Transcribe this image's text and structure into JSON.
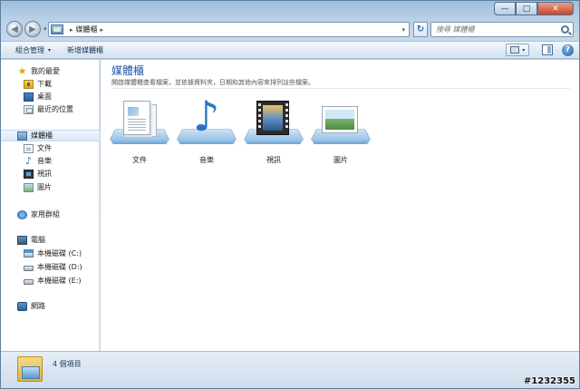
{
  "window": {
    "caption_buttons": {
      "minimize": "—",
      "maximize": "□",
      "close": "✕"
    }
  },
  "nav": {
    "back": "◀",
    "forward": "▶",
    "history_dropdown": "▾"
  },
  "address": {
    "icon": "library-icon",
    "separator": "▸",
    "path": "媒體櫃",
    "trailing_separator": "▸",
    "dropdown": "▾"
  },
  "refresh": {
    "glyph": "↻"
  },
  "search": {
    "placeholder": "搜尋 媒體櫃"
  },
  "toolbar": {
    "organize_label": "組合管理",
    "organize_dropdown": "▾",
    "new_library_label": "新增媒體櫃",
    "view_dropdown": "▾",
    "help_glyph": "?"
  },
  "sidebar": {
    "favorites": {
      "label": "我的最愛",
      "items": [
        {
          "label": "下載",
          "icon": "download-folder-icon"
        },
        {
          "label": "桌面",
          "icon": "desktop-icon"
        },
        {
          "label": "最近的位置",
          "icon": "recent-places-icon"
        }
      ]
    },
    "libraries": {
      "label": "媒體櫃",
      "items": [
        {
          "label": "文件",
          "icon": "documents-icon"
        },
        {
          "label": "音樂",
          "icon": "music-icon"
        },
        {
          "label": "視訊",
          "icon": "video-icon"
        },
        {
          "label": "圖片",
          "icon": "pictures-icon"
        }
      ]
    },
    "homegroup": {
      "label": "家用群組"
    },
    "computer": {
      "label": "電腦",
      "items": [
        {
          "label": "本機磁碟 (C:)",
          "icon": "system-drive-icon"
        },
        {
          "label": "本機磁碟 (D:)",
          "icon": "drive-icon"
        },
        {
          "label": "本機磁碟 (E:)",
          "icon": "drive-icon"
        }
      ]
    },
    "network": {
      "label": "網路"
    }
  },
  "main": {
    "title": "媒體櫃",
    "description": "開啟媒體櫃查看檔案，並依據資料夾，日期和其他內容來排列這些檔案。",
    "libraries": [
      {
        "label": "文件",
        "icon": "documents-library-icon"
      },
      {
        "label": "音樂",
        "icon": "music-library-icon"
      },
      {
        "label": "視訊",
        "icon": "video-library-icon"
      },
      {
        "label": "圖片",
        "icon": "pictures-library-icon"
      }
    ]
  },
  "details": {
    "item_count": "4 個項目"
  },
  "watermark": "#1232355",
  "colors": {
    "accent_title": "#1e5ba5",
    "frame": "#a9c3de",
    "close_button": "#c8442a"
  }
}
